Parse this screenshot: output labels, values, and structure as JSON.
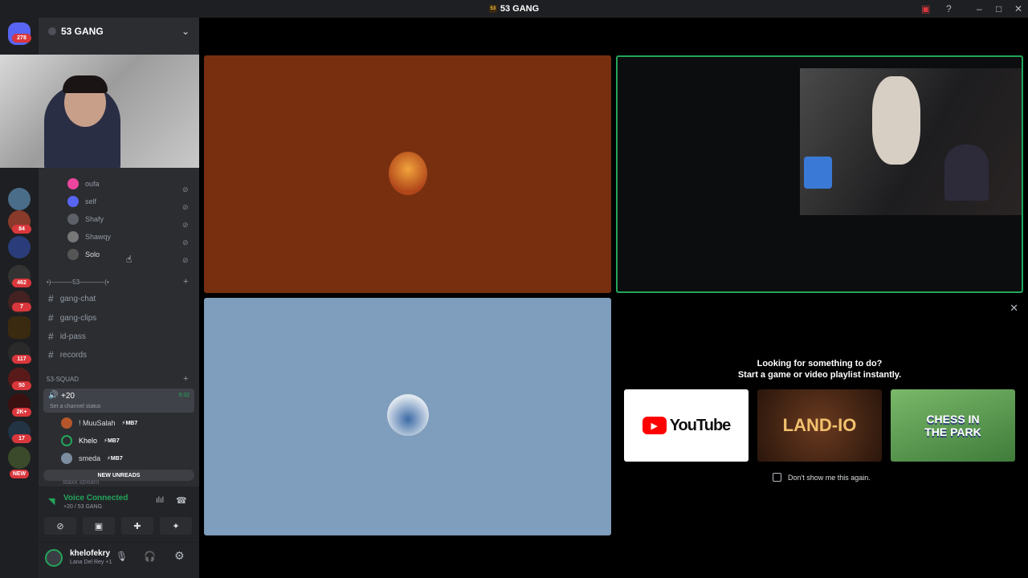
{
  "window": {
    "title": "53 GANG"
  },
  "server": {
    "name": "53 GANG"
  },
  "guilds": [
    {
      "badge": "278"
    },
    {
      "badge": "84"
    },
    {
      "badge": "462"
    },
    {
      "badge": "7"
    },
    {
      "badge": "117"
    },
    {
      "badge": "50"
    },
    {
      "badge": "2K+"
    },
    {
      "badge": "17"
    },
    {
      "badge": "NEW"
    }
  ],
  "voice_users_top": [
    {
      "name": "oufa"
    },
    {
      "name": "self"
    },
    {
      "name": "Shafy"
    },
    {
      "name": "Shawqy"
    },
    {
      "name": "Solo"
    }
  ],
  "category_divider": "•)‒‒‒‒‒‒53‒‒‒‒‒‒‒(•",
  "text_channels": [
    {
      "name": "gang-chat"
    },
    {
      "name": "gang-clips"
    },
    {
      "name": "id-pass"
    },
    {
      "name": "records"
    }
  ],
  "squad": {
    "category": "53-SQUAD",
    "channel": "+20",
    "time": "9:32",
    "status_placeholder": "Set a channel status",
    "members": [
      {
        "name": "! MuuSalah",
        "tag": "⚡MB7"
      },
      {
        "name": "Khelo",
        "tag": "⚡MB7"
      },
      {
        "name": "smeda",
        "tag": "⚡MB7"
      }
    ],
    "new_unreads": "NEW UNREADS",
    "next_channel": "staxx stream"
  },
  "voice": {
    "status": "Voice Connected",
    "channel": "+20 / 53 GANG"
  },
  "user": {
    "name": "khelofekry",
    "status": "Lana Del Rey +1"
  },
  "activity": {
    "line1": "Looking for something to do?",
    "line2": "Start a game or video playlist instantly.",
    "tiles": [
      {
        "label": "YouTube"
      },
      {
        "label": "LAND-IO"
      },
      {
        "label": "CHESS IN THE PARK"
      }
    ],
    "checkbox": "Don't show me this again."
  },
  "colors": {
    "tile1": "#772f0f",
    "tile3": "#7f9dbc",
    "accent": "#23a55a"
  }
}
